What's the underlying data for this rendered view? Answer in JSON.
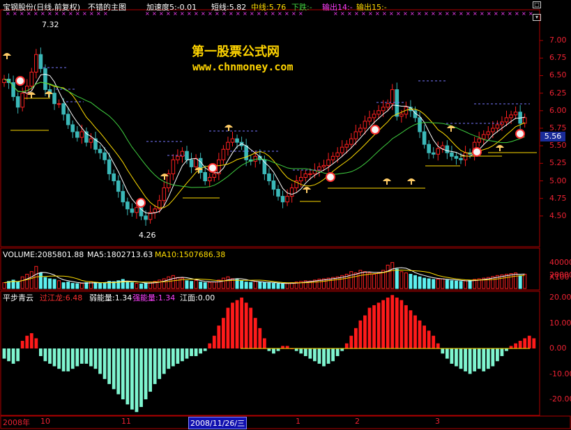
{
  "header": {
    "name": "宝钢股份(日线,前复权)",
    "indicator": "不错的主图",
    "accel": "加速度5:-0.01",
    "short": "短线:5.82",
    "mid": "中线:5.76",
    "down": "下跌:-",
    "out14": "输出14:-",
    "out15": "输出15:-"
  },
  "watermark": {
    "line1": "第一股票公式网",
    "line2": "www.chnmoney.com"
  },
  "price_panel": {
    "current_price": "5.56",
    "high_label": "7.32",
    "low_label": "4.26",
    "yticks": [
      "7.00",
      "6.75",
      "6.50",
      "6.25",
      "6.00",
      "5.75",
      "5.50",
      "5.25",
      "5.00",
      "4.75",
      "4.50"
    ]
  },
  "volume_panel": {
    "ma_line": "VOLUME:2085801.88",
    "ma5": "MA5:1802713.63",
    "ma10": "MA10:1507686.38",
    "yticks": [
      "40000",
      "20000",
      "X100"
    ]
  },
  "osc_panel": {
    "title": "平步青云",
    "guo": "过江龙:6.48",
    "weak": "弱能量:1.34",
    "strong": "强能量:1.34",
    "river": "江面:0.00",
    "yticks": [
      "20.00",
      "10.00",
      "0.00",
      "-10.00",
      "-20.00"
    ]
  },
  "xaxis": {
    "labels": [
      "2008年",
      "10",
      "11",
      "1",
      "2",
      "3"
    ],
    "selected": "2008/11/26/三"
  },
  "colors": {
    "up": "#ff2020",
    "down": "#3bb8b8",
    "osc_pos": "#ff1a1a",
    "osc_neg": "#7ff5d0",
    "ma_short": "#ffffff",
    "ma_mid": "#ffdd00",
    "ma_long": "#40d040"
  },
  "chart_data": [
    {
      "type": "candlestick",
      "title": "宝钢股份(日线,前复权)",
      "ylim": [
        4.3,
        7.2
      ],
      "closes": [
        6.45,
        6.4,
        6.2,
        6.05,
        6.25,
        6.35,
        6.55,
        6.8,
        6.6,
        6.3,
        6.25,
        6.1,
        6.1,
        5.95,
        5.8,
        5.7,
        5.62,
        5.7,
        5.55,
        5.6,
        5.45,
        5.4,
        5.3,
        5.1,
        5.0,
        4.85,
        4.7,
        4.6,
        4.55,
        4.62,
        4.5,
        4.45,
        4.55,
        4.6,
        4.72,
        4.9,
        5.1,
        5.3,
        5.35,
        5.42,
        5.3,
        5.2,
        5.32,
        5.12,
        5.0,
        5.05,
        5.1,
        5.3,
        5.45,
        5.55,
        5.6,
        5.55,
        5.5,
        5.3,
        5.28,
        5.35,
        5.3,
        5.1,
        5.0,
        4.88,
        4.78,
        4.7,
        4.78,
        4.9,
        5.0,
        5.05,
        5.1,
        5.1,
        5.15,
        5.2,
        5.22,
        5.3,
        5.35,
        5.4,
        5.48,
        5.52,
        5.6,
        5.7,
        5.75,
        5.85,
        5.9,
        5.95,
        6.0,
        6.05,
        6.1,
        6.3,
        5.92,
        5.95,
        6.05,
        6.0,
        5.9,
        5.7,
        5.52,
        5.4,
        5.38,
        5.46,
        5.5,
        5.4,
        5.35,
        5.32,
        5.3,
        5.4,
        5.38,
        5.55,
        5.6,
        5.66,
        5.7,
        5.75,
        5.8,
        5.84,
        5.9,
        5.94,
        5.98,
        5.82,
        5.9
      ],
      "series": [
        {
          "name": "短线",
          "values": []
        },
        {
          "name": "中线",
          "values": []
        }
      ]
    },
    {
      "type": "bar",
      "title": "VOLUME",
      "ylim": [
        0,
        45000
      ],
      "values": [
        9000,
        11000,
        13000,
        10000,
        18000,
        22000,
        26000,
        34000,
        24000,
        17000,
        15000,
        14000,
        12000,
        9000,
        10000,
        8000,
        7500,
        8000,
        9000,
        10500,
        9500,
        8000,
        9000,
        11000,
        10500,
        12000,
        14000,
        10000,
        9000,
        8000,
        7000,
        8500,
        9500,
        11000,
        13000,
        15000,
        18000,
        20000,
        17000,
        16000,
        12000,
        11000,
        12500,
        10000,
        9000,
        9500,
        10000,
        13000,
        16000,
        18000,
        15000,
        14000,
        12000,
        10000,
        9500,
        11000,
        10000,
        9000,
        8500,
        8000,
        7500,
        7000,
        8000,
        9000,
        10000,
        11000,
        12000,
        11500,
        13000,
        14500,
        15000,
        16000,
        17000,
        18000,
        20000,
        22000,
        26000,
        24000,
        28000,
        26000,
        24000,
        22000,
        24000,
        28000,
        36000,
        40000,
        30000,
        26000,
        24000,
        22000,
        20000,
        18000,
        16000,
        15000,
        14000,
        14500,
        15000,
        13000,
        12000,
        11500,
        11000,
        12000,
        12500,
        14000,
        15000,
        16000,
        17000,
        18500,
        20000,
        21000,
        22000,
        23000,
        24000,
        20000,
        22000
      ]
    },
    {
      "type": "bar",
      "title": "平步青云",
      "ylim": [
        -25,
        25
      ],
      "values": [
        -4,
        -5,
        -6,
        -5,
        3,
        5,
        6,
        4,
        -3,
        -5,
        -6,
        -7,
        -8,
        -9,
        -9,
        -8,
        -7,
        -6,
        -6,
        -7,
        -8,
        -10,
        -12,
        -14,
        -16,
        -18,
        -20,
        -22,
        -24,
        -25,
        -23,
        -20,
        -17,
        -14,
        -12,
        -10,
        -8,
        -7,
        -6,
        -5,
        -4,
        -3,
        -3,
        -2,
        -1,
        2,
        5,
        9,
        12,
        16,
        18,
        19,
        20,
        18,
        16,
        12,
        8,
        4,
        -1,
        -2,
        -1,
        1,
        1,
        0,
        -1,
        -2,
        -3,
        -4,
        -5,
        -6,
        -7,
        -6,
        -5,
        -3,
        -1,
        2,
        5,
        8,
        11,
        13,
        16,
        17,
        18,
        19,
        20,
        21,
        20,
        19,
        17,
        15,
        13,
        11,
        9,
        7,
        5,
        2,
        -2,
        -4,
        -6,
        -7,
        -8,
        -9,
        -10,
        -9,
        -8,
        -9,
        -8,
        -7,
        -5,
        -3,
        -1,
        1,
        2,
        3,
        4,
        5,
        4
      ]
    }
  ]
}
